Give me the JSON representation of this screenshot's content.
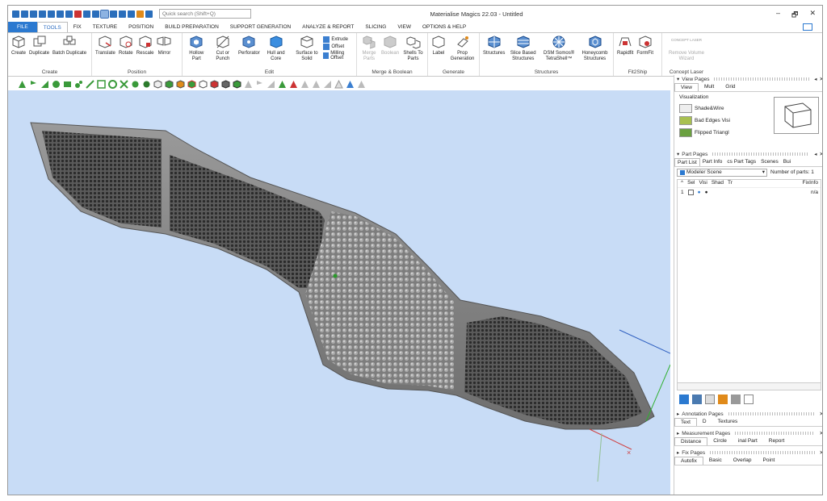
{
  "app_title": "Materialise Magics 22.03 - Untitled",
  "search_placeholder": "Quick search (Shift+Q)",
  "window_controls": [
    "–",
    "🗗",
    "✕"
  ],
  "menu_tabs": [
    "FILE",
    "TOOLS",
    "FIX",
    "TEXTURE",
    "POSITION",
    "BUILD PREPARATION",
    "SUPPORT GENERATION",
    "ANALYZE & REPORT",
    "SLICING",
    "VIEW",
    "OPTIONS & HELP"
  ],
  "ribbon": {
    "create": {
      "label": "Create",
      "buttons": [
        "Create",
        "Duplicate",
        "Batch Duplicate"
      ]
    },
    "position": {
      "label": "Position",
      "buttons": [
        "Translate",
        "Rotate",
        "Rescale",
        "Mirror"
      ]
    },
    "edit": {
      "label": "Edit",
      "buttons": [
        "Hollow Part",
        "Cut or Punch",
        "Perforator",
        "Hull and Core",
        "Surface to Solid"
      ],
      "small": [
        "Extrude",
        "Offset",
        "Milling Offset"
      ]
    },
    "merge": {
      "label": "Merge & Boolean",
      "buttons": [
        "Merge Parts",
        "Boolean",
        "Shells To Parts"
      ]
    },
    "generate": {
      "label": "Generate",
      "buttons": [
        "Label",
        "Prop Generation"
      ]
    },
    "structures": {
      "label": "Structures",
      "buttons": [
        "Structures",
        "Slice Based Structures",
        "DSM Somos® TetraShell™",
        "Honeycomb Structures"
      ]
    },
    "fit2ship": {
      "label": "Fit2Ship",
      "buttons": [
        "Rapidfit",
        "FormFit"
      ]
    },
    "concept": {
      "label": "Concept Laser",
      "buttons": [
        "Remove Volume Wizard"
      ],
      "logo": "CONCEPT LASER"
    }
  },
  "panels": {
    "view_pages": {
      "title": "View Pages",
      "tabs": [
        "View",
        "Mult",
        "Grid"
      ],
      "section": "Visualization",
      "items": [
        "Shade&Wire",
        "Bad Edges Visi",
        "Flipped Triangl"
      ]
    },
    "part_pages": {
      "title": "Part Pages",
      "tabs": [
        "Part List",
        "Part Info",
        "cs Part Tags",
        "Scenes",
        "Bui"
      ],
      "scene": "Modeler Scene",
      "parts_count_label": "Number of parts: 1",
      "columns": [
        "Sel",
        "Visi",
        "Shad",
        "Tr",
        "FixInfo"
      ],
      "rows": [
        {
          "num": "1",
          "fixinfo": "n/a"
        }
      ]
    },
    "annotation_pages": {
      "title": "Annotation Pages",
      "tabs": [
        "Text",
        "D",
        "Textures"
      ]
    },
    "measurement_pages": {
      "title": "Measurement Pages",
      "tabs": [
        "Distance",
        "Circle",
        "inal Part",
        "Report"
      ]
    },
    "fix_pages": {
      "title": "Fix Pages",
      "tabs": [
        "Autofix",
        "Basic",
        "Overlap",
        "Point"
      ]
    }
  },
  "colors": {
    "accent": "#2b79d0",
    "viewport_bg": "#c8dcf6",
    "part_gray": "#8d8d8d"
  }
}
